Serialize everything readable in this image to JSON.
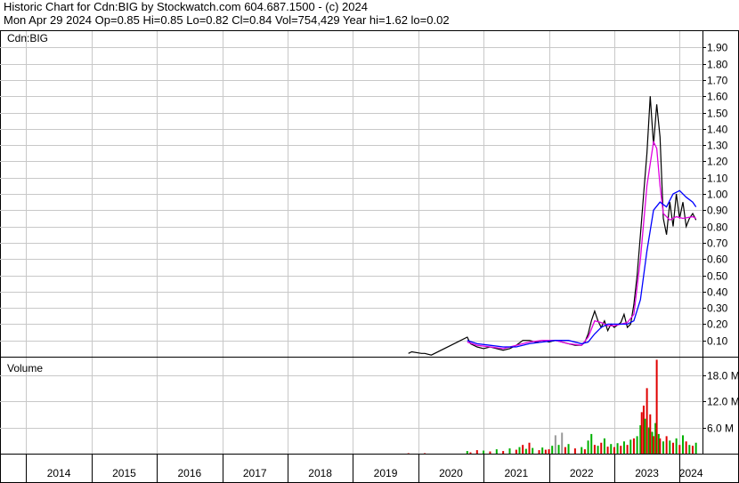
{
  "header": {
    "line1": "Historic Chart for Cdn:BIG by Stockwatch.com 604.687.1500 - (c) 2024",
    "line2": "Mon Apr 29 2024   Op=0.85   Hi=0.85   Lo=0.82   Cl=0.84   Vol=754,429   Year hi=1.62   lo=0.02"
  },
  "chart_data": {
    "type": "line",
    "title": "Cdn:BIG",
    "volume_label": "Volume",
    "price_axis": {
      "ylim": [
        0,
        2.0
      ],
      "ticks": [
        "0.10",
        "0.20",
        "0.30",
        "0.40",
        "0.50",
        "0.60",
        "0.70",
        "0.80",
        "0.90",
        "1.00",
        "1.10",
        "1.20",
        "1.30",
        "1.40",
        "1.50",
        "1.60",
        "1.70",
        "1.80",
        "1.90"
      ]
    },
    "volume_axis": {
      "ylim": [
        0,
        22
      ],
      "ticks": [
        {
          "v": 6,
          "t": "6.0 M"
        },
        {
          "v": 12,
          "t": "12.0 M"
        },
        {
          "v": 18,
          "t": "18.0 M"
        }
      ]
    },
    "x_labels": [
      "2014",
      "2015",
      "2016",
      "2017",
      "2018",
      "2019",
      "2020",
      "2021",
      "2022",
      "2023",
      "2024"
    ],
    "x_range": [
      2013.6,
      2024.35
    ],
    "grid": true,
    "colors": {
      "price": "#000000",
      "ma_short": "#e000e0",
      "ma_long": "#0000ff",
      "vol_up": "#00b000",
      "vol_down": "#e00000",
      "vol_neutral": "#999999",
      "grid": "#c8c8c8"
    },
    "series": [
      {
        "key": "price",
        "points": [
          [
            2019.85,
            0.02
          ],
          [
            2019.9,
            0.03
          ],
          [
            2020.05,
            0.02
          ],
          [
            2020.1,
            0.02
          ],
          [
            2020.2,
            0.01
          ],
          [
            2020.75,
            0.12
          ],
          [
            2020.8,
            0.08
          ],
          [
            2020.9,
            0.06
          ],
          [
            2021.0,
            0.05
          ],
          [
            2021.1,
            0.06
          ],
          [
            2021.2,
            0.05
          ],
          [
            2021.3,
            0.04
          ],
          [
            2021.4,
            0.05
          ],
          [
            2021.5,
            0.07
          ],
          [
            2021.6,
            0.1
          ],
          [
            2021.7,
            0.1
          ],
          [
            2021.8,
            0.09
          ],
          [
            2021.9,
            0.1
          ],
          [
            2022.0,
            0.09
          ],
          [
            2022.1,
            0.1
          ],
          [
            2022.2,
            0.09
          ],
          [
            2022.3,
            0.08
          ],
          [
            2022.4,
            0.07
          ],
          [
            2022.5,
            0.07
          ],
          [
            2022.55,
            0.09
          ],
          [
            2022.6,
            0.14
          ],
          [
            2022.65,
            0.22
          ],
          [
            2022.7,
            0.28
          ],
          [
            2022.75,
            0.22
          ],
          [
            2022.8,
            0.18
          ],
          [
            2022.85,
            0.22
          ],
          [
            2022.9,
            0.16
          ],
          [
            2022.95,
            0.2
          ],
          [
            2023.0,
            0.18
          ],
          [
            2023.1,
            0.21
          ],
          [
            2023.15,
            0.26
          ],
          [
            2023.2,
            0.18
          ],
          [
            2023.25,
            0.2
          ],
          [
            2023.3,
            0.32
          ],
          [
            2023.35,
            0.5
          ],
          [
            2023.4,
            0.75
          ],
          [
            2023.45,
            1.0
          ],
          [
            2023.5,
            1.25
          ],
          [
            2023.55,
            1.6
          ],
          [
            2023.6,
            1.3
          ],
          [
            2023.65,
            1.55
          ],
          [
            2023.7,
            1.35
          ],
          [
            2023.75,
            0.85
          ],
          [
            2023.8,
            0.75
          ],
          [
            2023.85,
            0.95
          ],
          [
            2023.9,
            0.8
          ],
          [
            2023.95,
            1.0
          ],
          [
            2024.0,
            0.85
          ],
          [
            2024.05,
            0.95
          ],
          [
            2024.1,
            0.8
          ],
          [
            2024.15,
            0.85
          ],
          [
            2024.2,
            0.88
          ],
          [
            2024.25,
            0.84
          ]
        ]
      },
      {
        "key": "ma_short",
        "points": [
          [
            2020.75,
            0.09
          ],
          [
            2020.9,
            0.07
          ],
          [
            2021.1,
            0.06
          ],
          [
            2021.3,
            0.05
          ],
          [
            2021.5,
            0.07
          ],
          [
            2021.7,
            0.09
          ],
          [
            2021.9,
            0.1
          ],
          [
            2022.1,
            0.1
          ],
          [
            2022.3,
            0.08
          ],
          [
            2022.5,
            0.07
          ],
          [
            2022.6,
            0.12
          ],
          [
            2022.7,
            0.22
          ],
          [
            2022.8,
            0.21
          ],
          [
            2022.9,
            0.19
          ],
          [
            2023.0,
            0.19
          ],
          [
            2023.1,
            0.2
          ],
          [
            2023.2,
            0.21
          ],
          [
            2023.3,
            0.26
          ],
          [
            2023.4,
            0.6
          ],
          [
            2023.5,
            1.05
          ],
          [
            2023.6,
            1.32
          ],
          [
            2023.65,
            1.28
          ],
          [
            2023.7,
            1.05
          ],
          [
            2023.75,
            0.88
          ],
          [
            2023.85,
            0.84
          ],
          [
            2023.95,
            0.86
          ],
          [
            2024.05,
            0.85
          ],
          [
            2024.2,
            0.86
          ],
          [
            2024.25,
            0.85
          ]
        ]
      },
      {
        "key": "ma_long",
        "points": [
          [
            2020.75,
            0.1
          ],
          [
            2020.9,
            0.08
          ],
          [
            2021.1,
            0.07
          ],
          [
            2021.3,
            0.06
          ],
          [
            2021.5,
            0.06
          ],
          [
            2021.7,
            0.08
          ],
          [
            2021.9,
            0.09
          ],
          [
            2022.1,
            0.1
          ],
          [
            2022.3,
            0.1
          ],
          [
            2022.5,
            0.08
          ],
          [
            2022.6,
            0.09
          ],
          [
            2022.7,
            0.14
          ],
          [
            2022.8,
            0.18
          ],
          [
            2022.9,
            0.2
          ],
          [
            2023.0,
            0.2
          ],
          [
            2023.1,
            0.2
          ],
          [
            2023.2,
            0.2
          ],
          [
            2023.3,
            0.22
          ],
          [
            2023.4,
            0.35
          ],
          [
            2023.5,
            0.65
          ],
          [
            2023.6,
            0.9
          ],
          [
            2023.7,
            0.95
          ],
          [
            2023.8,
            0.92
          ],
          [
            2023.9,
            1.0
          ],
          [
            2024.0,
            1.02
          ],
          [
            2024.1,
            0.98
          ],
          [
            2024.2,
            0.95
          ],
          [
            2024.25,
            0.92
          ]
        ]
      }
    ],
    "volume": [
      [
        2019.85,
        0.1,
        "down"
      ],
      [
        2020.1,
        0.1,
        "down"
      ],
      [
        2020.75,
        0.6,
        "up"
      ],
      [
        2020.8,
        0.3,
        "down"
      ],
      [
        2020.9,
        0.8,
        "down"
      ],
      [
        2021.0,
        0.7,
        "up"
      ],
      [
        2021.1,
        0.5,
        "down"
      ],
      [
        2021.2,
        1.0,
        "up"
      ],
      [
        2021.3,
        0.6,
        "down"
      ],
      [
        2021.4,
        1.2,
        "up"
      ],
      [
        2021.5,
        0.9,
        "down"
      ],
      [
        2021.55,
        1.5,
        "up"
      ],
      [
        2021.6,
        2.0,
        "down"
      ],
      [
        2021.65,
        1.1,
        "up"
      ],
      [
        2021.7,
        2.5,
        "down"
      ],
      [
        2021.75,
        1.3,
        "up"
      ],
      [
        2021.85,
        0.8,
        "down"
      ],
      [
        2021.9,
        1.4,
        "up"
      ],
      [
        2021.95,
        0.9,
        "down"
      ],
      [
        2022.0,
        1.0,
        "down"
      ],
      [
        2022.05,
        1.8,
        "up"
      ],
      [
        2022.1,
        4.2,
        "neutral"
      ],
      [
        2022.15,
        2.0,
        "up"
      ],
      [
        2022.2,
        4.8,
        "neutral"
      ],
      [
        2022.25,
        1.5,
        "down"
      ],
      [
        2022.3,
        2.2,
        "up"
      ],
      [
        2022.4,
        1.2,
        "down"
      ],
      [
        2022.5,
        1.5,
        "up"
      ],
      [
        2022.55,
        1.0,
        "down"
      ],
      [
        2022.6,
        3.0,
        "up"
      ],
      [
        2022.65,
        4.5,
        "up"
      ],
      [
        2022.7,
        2.0,
        "down"
      ],
      [
        2022.75,
        1.8,
        "up"
      ],
      [
        2022.8,
        2.5,
        "down"
      ],
      [
        2022.85,
        3.5,
        "up"
      ],
      [
        2022.9,
        1.6,
        "down"
      ],
      [
        2022.95,
        2.2,
        "up"
      ],
      [
        2023.0,
        1.5,
        "down"
      ],
      [
        2023.05,
        2.4,
        "up"
      ],
      [
        2023.1,
        1.8,
        "down"
      ],
      [
        2023.15,
        2.8,
        "up"
      ],
      [
        2023.2,
        2.0,
        "down"
      ],
      [
        2023.25,
        3.2,
        "up"
      ],
      [
        2023.3,
        3.5,
        "down"
      ],
      [
        2023.35,
        4.0,
        "up"
      ],
      [
        2023.4,
        6.5,
        "up"
      ],
      [
        2023.42,
        9.5,
        "down"
      ],
      [
        2023.45,
        11.0,
        "down"
      ],
      [
        2023.47,
        8.0,
        "up"
      ],
      [
        2023.5,
        15.0,
        "down"
      ],
      [
        2023.53,
        6.0,
        "up"
      ],
      [
        2023.55,
        9.0,
        "down"
      ],
      [
        2023.58,
        5.0,
        "up"
      ],
      [
        2023.6,
        4.0,
        "down"
      ],
      [
        2023.63,
        7.0,
        "up"
      ],
      [
        2023.65,
        21.5,
        "down"
      ],
      [
        2023.68,
        4.5,
        "up"
      ],
      [
        2023.7,
        3.5,
        "down"
      ],
      [
        2023.75,
        2.8,
        "up"
      ],
      [
        2023.8,
        4.0,
        "down"
      ],
      [
        2023.85,
        3.0,
        "up"
      ],
      [
        2023.9,
        2.5,
        "down"
      ],
      [
        2023.95,
        3.5,
        "up"
      ],
      [
        2024.0,
        2.0,
        "down"
      ],
      [
        2024.05,
        4.2,
        "up"
      ],
      [
        2024.1,
        2.8,
        "down"
      ],
      [
        2024.15,
        2.0,
        "up"
      ],
      [
        2024.2,
        1.8,
        "down"
      ],
      [
        2024.25,
        2.5,
        "up"
      ]
    ]
  }
}
